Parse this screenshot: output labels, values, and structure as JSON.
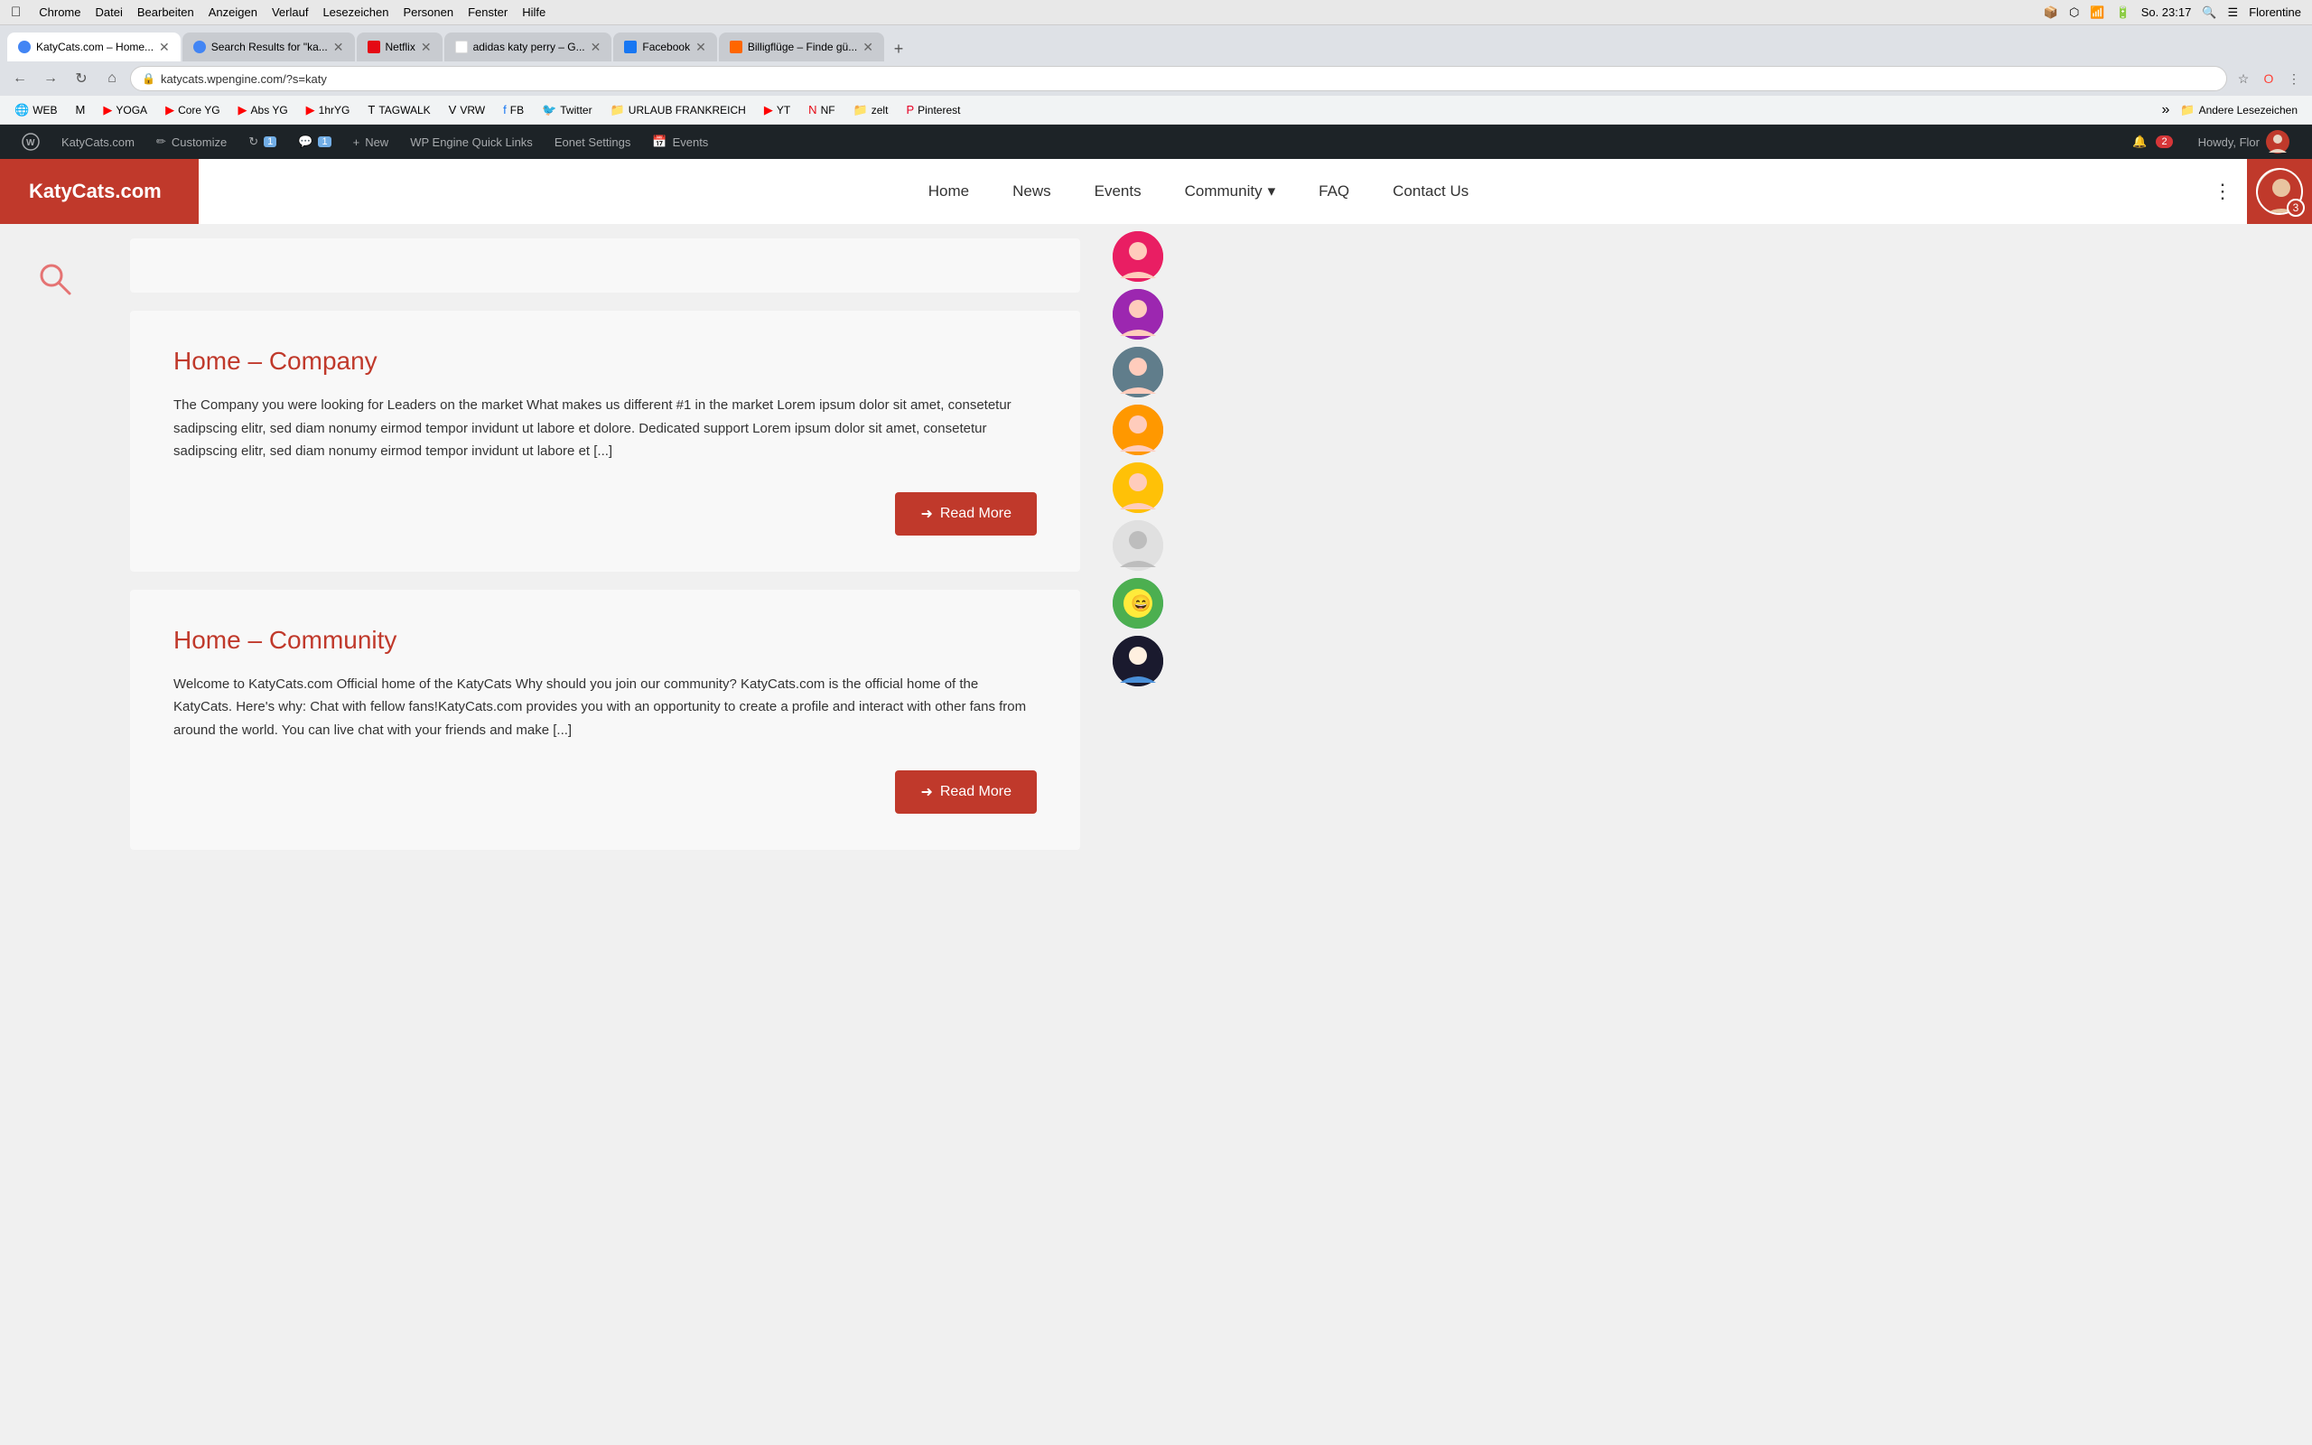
{
  "macos": {
    "menubar": {
      "apple": "&#63743;",
      "items": [
        "Chrome",
        "Datei",
        "Bearbeiten",
        "Anzeigen",
        "Verlauf",
        "Lesezeichen",
        "Personen",
        "Fenster",
        "Hilfe"
      ],
      "time": "So. 23:17",
      "user": "Florentine"
    }
  },
  "browser": {
    "tabs": [
      {
        "id": "tab1",
        "favicon_type": "globe",
        "label": "KatyCats.com – Home...",
        "active": true
      },
      {
        "id": "tab2",
        "favicon_type": "globe",
        "label": "Search Results for \"ka...",
        "active": false
      },
      {
        "id": "tab3",
        "favicon_type": "netflix",
        "label": "Netflix",
        "active": false
      },
      {
        "id": "tab4",
        "favicon_type": "google",
        "label": "adidas katy perry – G...",
        "active": false
      },
      {
        "id": "tab5",
        "favicon_type": "facebook",
        "label": "Facebook",
        "active": false
      },
      {
        "id": "tab6",
        "favicon_type": "billig",
        "label": "Billigflüge – Finde gü...",
        "active": false
      }
    ],
    "url": "katycats.wpengine.com/?s=katy",
    "bookmarks": [
      {
        "label": "WEB",
        "icon": "🌐"
      },
      {
        "label": "M",
        "icon": "✉"
      },
      {
        "label": "YOGA",
        "icon": "▶"
      },
      {
        "label": "Core YG",
        "icon": "▶"
      },
      {
        "label": "Abs YG",
        "icon": "▶"
      },
      {
        "label": "1hrYG",
        "icon": "▶"
      },
      {
        "label": "TAGWALK",
        "icon": "T"
      },
      {
        "label": "VRW",
        "icon": "V"
      },
      {
        "label": "FB",
        "icon": "f"
      },
      {
        "label": "Twitter",
        "icon": "🐦"
      },
      {
        "label": "URLAUB FRANKREICH",
        "icon": "📁"
      },
      {
        "label": "YT",
        "icon": "▶"
      },
      {
        "label": "NF",
        "icon": "N"
      },
      {
        "label": "zelt",
        "icon": "📁"
      },
      {
        "label": "Pinterest",
        "icon": "P"
      }
    ]
  },
  "wp_admin": {
    "items": [
      {
        "label": "KatyCats.com",
        "icon": "wp"
      },
      {
        "label": "Customize",
        "icon": "✏"
      },
      {
        "label": "1",
        "icon": "↻",
        "badge": null
      },
      {
        "label": "1",
        "icon": "💬",
        "badge": null
      },
      {
        "label": "New",
        "icon": "+",
        "badge": null
      }
    ],
    "quick_links": "WP Engine Quick Links",
    "eonet": "Eonet Settings",
    "events": "Events",
    "howdy": "Howdy, Flor",
    "comment_count": "1",
    "update_count": "1",
    "new_label": "New",
    "notification_count": "2"
  },
  "site": {
    "logo": "KatyCats.com",
    "nav": {
      "home": "Home",
      "news": "News",
      "events": "Events",
      "community": "Community",
      "faq": "FAQ",
      "contact": "Contact Us"
    },
    "notification_count": "3"
  },
  "search": {
    "icon": "🔍"
  },
  "cards": [
    {
      "id": "card-company",
      "title": "Home – Company",
      "excerpt": "The Company you were looking for Leaders on the market What makes us different #1 in the market Lorem ipsum dolor sit amet, consetetur sadipscing elitr, sed diam nonumy eirmod tempor invidunt ut labore et dolore. Dedicated support Lorem ipsum dolor sit amet, consetetur sadipscing elitr, sed diam nonumy eirmod tempor invidunt ut labore et [...]",
      "read_more": "Read More"
    },
    {
      "id": "card-community",
      "title": "Home – Community",
      "excerpt": "Welcome to KatyCats.com Official home of the KatyCats Why should you join our community? KatyCats.com is the official home of the KatyCats. Here's why: Chat with fellow fans!KatyCats.com provides you with an opportunity to create a profile and interact with other fans from around the world. You can live chat with your friends and make [...]",
      "read_more": "Read More"
    }
  ],
  "avatars": [
    {
      "id": "av1",
      "color_class": "av1",
      "emoji": "👩"
    },
    {
      "id": "av2",
      "color_class": "av2",
      "emoji": "👩"
    },
    {
      "id": "av3",
      "color_class": "av3",
      "emoji": "👩"
    },
    {
      "id": "av4",
      "color_class": "av4",
      "emoji": "👩"
    },
    {
      "id": "av5",
      "color_class": "av5",
      "emoji": "👩"
    },
    {
      "id": "av6",
      "color_class": "av6",
      "emoji": "👤"
    },
    {
      "id": "av7",
      "color_class": "av7",
      "emoji": "😄"
    },
    {
      "id": "av8",
      "color_class": "av8",
      "emoji": "💅"
    }
  ]
}
